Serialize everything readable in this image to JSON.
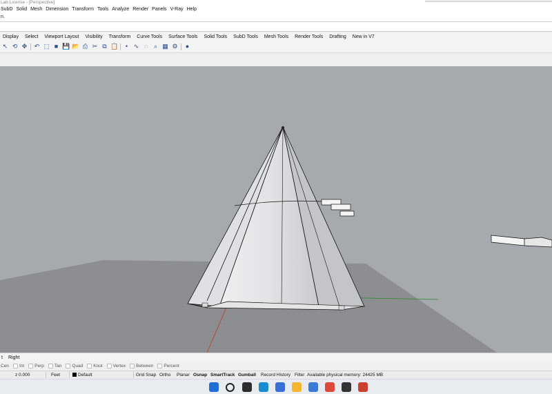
{
  "window": {
    "title": "Lab License - [Perspective]"
  },
  "menu": [
    "SubD",
    "Solid",
    "Mesh",
    "Dimension",
    "Transform",
    "Tools",
    "Analyze",
    "Render",
    "Panels",
    "V-Ray",
    "Help"
  ],
  "command": {
    "prompt": "n."
  },
  "toolbar_tabs": [
    "Display",
    "Select",
    "Viewport Layout",
    "Visibility",
    "Transform",
    "Curve Tools",
    "Surface Tools",
    "Solid Tools",
    "SubD Tools",
    "Mesh Tools",
    "Render Tools",
    "Drafting",
    "New in V7"
  ],
  "toolbar_icons": [
    "cursor-icon",
    "rotate-view-icon",
    "pan-icon",
    "undo-icon",
    "select-icon",
    "box-icon",
    "save-icon",
    "open-folder-icon",
    "print-icon",
    "cut-icon",
    "copy-icon",
    "paste-icon",
    "point-icon",
    "curve-icon",
    "lasso-icon",
    "zoom-icon",
    "viewport-icon",
    "properties-icon",
    "render-sphere-icon"
  ],
  "viewport_tabs": [
    "t",
    "Right"
  ],
  "osnap": [
    "Cen",
    "Int",
    "Perp",
    "Tan",
    "Quad",
    "Knot",
    "Vertex",
    "Between",
    "Percent"
  ],
  "status": {
    "coord": "z 0.000",
    "units": "Feet",
    "layer": "Default",
    "grid_snap": "Grid Snap",
    "ortho": "Ortho",
    "planar": "Planar",
    "osnap": "Osnap",
    "smarttrack": "SmartTrack",
    "gumball": "Gumball",
    "record_history": "Record History",
    "filter": "Filter",
    "memory": "Available physical memory: 24425 MB"
  },
  "colors": {
    "viewport_bg": "#a6a9ad",
    "grid_plane": "#8d8f92",
    "x_axis": "#c0392b",
    "y_axis": "#2e8b2e",
    "layer_swatch": "#000000"
  },
  "taskbar_icons": [
    "windows-start-icon",
    "search-icon",
    "file-explorer-icon",
    "edge-icon",
    "store-icon",
    "folder-icon",
    "photos-icon",
    "chrome-icon",
    "app-icon",
    "rhino-icon"
  ]
}
